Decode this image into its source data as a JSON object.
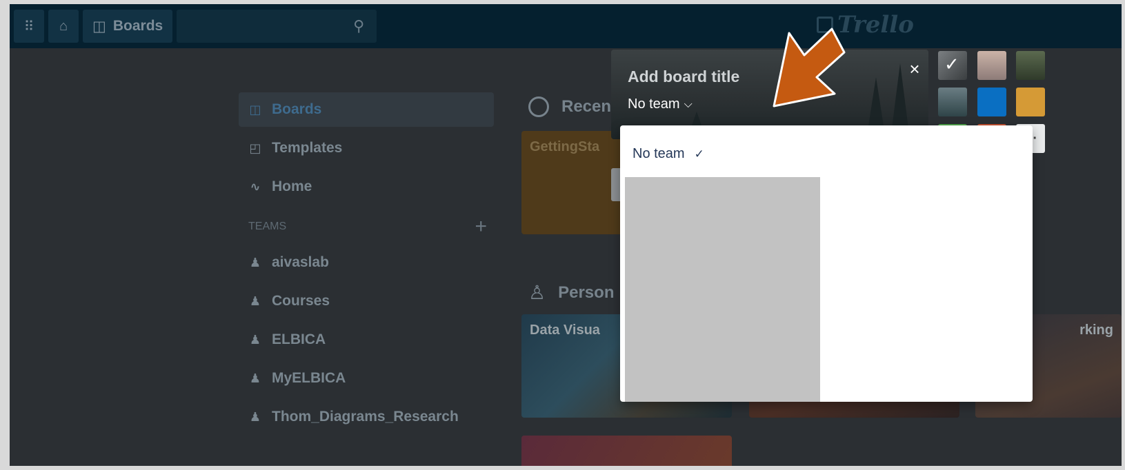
{
  "header": {
    "boards_label": "Boards",
    "logo_text": "Trello",
    "search_placeholder": ""
  },
  "sidebar": {
    "items": [
      {
        "label": "Boards",
        "icon": "boards-icon",
        "active": true
      },
      {
        "label": "Templates",
        "icon": "templates-icon"
      },
      {
        "label": "Home",
        "icon": "activity-icon"
      }
    ],
    "teams_label": "TEAMS",
    "teams_add": "+",
    "teams": [
      {
        "label": "aivaslab"
      },
      {
        "label": "Courses"
      },
      {
        "label": "ELBICA"
      },
      {
        "label": "MyELBICA"
      },
      {
        "label": "Thom_Diagrams_Research"
      }
    ]
  },
  "main": {
    "recent_label": "Recen",
    "personal_label": "Person",
    "tiles": {
      "getting_started": "GettingSta",
      "data_vis": "Data Visua",
      "working": "rking"
    }
  },
  "create_board": {
    "title_placeholder": "Add board title",
    "team_value": "No team",
    "close": "×",
    "more": "···"
  },
  "dropdown": {
    "option_no_team": "No team"
  },
  "colors": {
    "header_bg": "#05202f",
    "annotation_arrow": "#c55a11",
    "dropdown_text": "#253858"
  }
}
